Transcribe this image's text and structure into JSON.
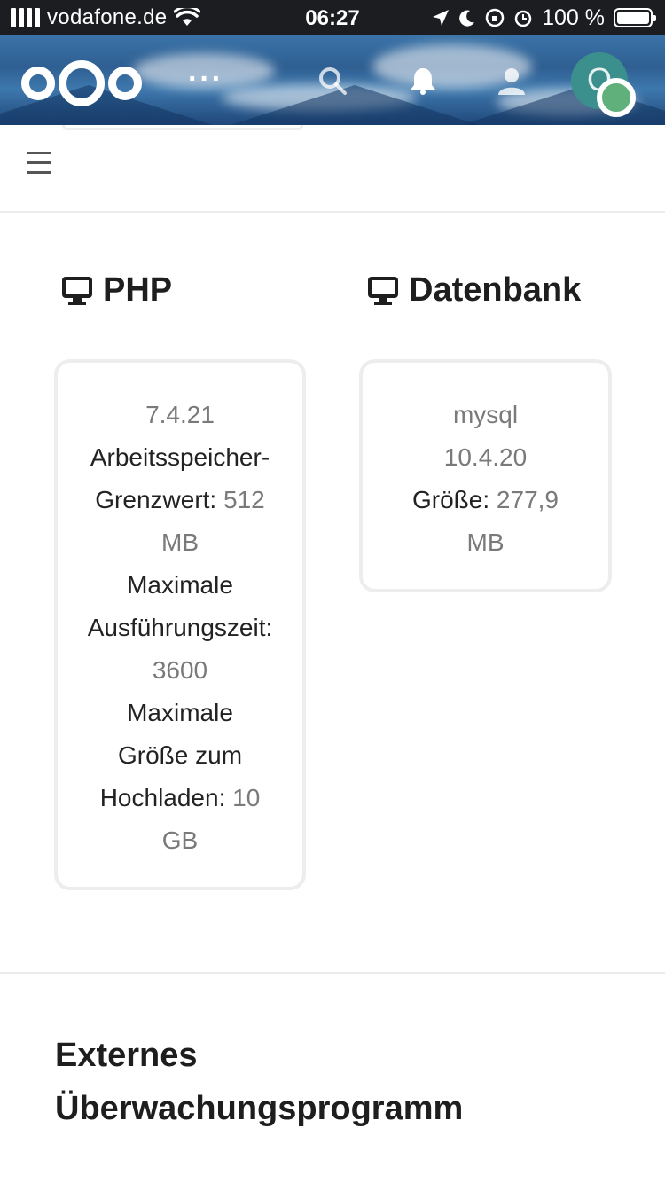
{
  "status_bar": {
    "carrier": "vodafone.de",
    "time": "06:27",
    "battery_percent": "100 %"
  },
  "header": {
    "more_label": "···",
    "icons": [
      "nextcloud-logo",
      "search-icon",
      "notifications-icon",
      "contacts-icon",
      "user-avatar"
    ],
    "avatar_letter": "O",
    "status_color": "#5fb07b"
  },
  "sections": {
    "php": {
      "title": "PHP",
      "version": "7.4.21",
      "memory_label": "Arbeitsspeicher-",
      "memory_label2": "Grenzwert:",
      "memory_value": "512",
      "memory_unit": "MB",
      "exec_label": "Maximale",
      "exec_label2": "Ausführungszeit:",
      "exec_value": "3600",
      "upload_label": "Maximale",
      "upload_label2": "Größe zum",
      "upload_label3": "Hochladen:",
      "upload_value": "10",
      "upload_unit": "GB"
    },
    "database": {
      "title": "Datenbank",
      "type": "mysql",
      "version": "10.4.20",
      "size_label": "Größe:",
      "size_value": "277,9",
      "size_unit": "MB"
    },
    "external_monitoring": {
      "title_line1": "Externes",
      "title_line2": "Überwachungsprogramm"
    }
  }
}
